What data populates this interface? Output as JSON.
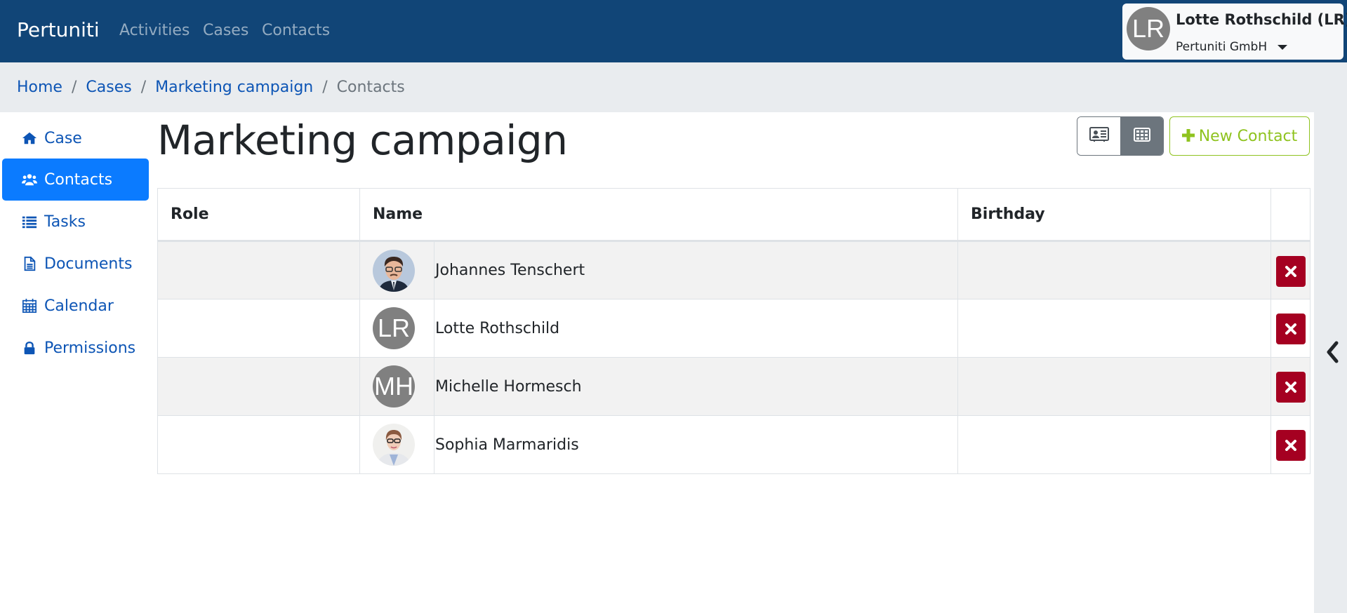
{
  "navbar": {
    "brand": "Pertuniti",
    "links": [
      "Activities",
      "Cases",
      "Contacts"
    ],
    "user": {
      "initials": "LR",
      "name": "Lotte Rothschild (LR)",
      "org": "Pertuniti GmbH"
    }
  },
  "breadcrumb": {
    "items": [
      "Home",
      "Cases",
      "Marketing campaign"
    ],
    "current": "Contacts",
    "separator": "/"
  },
  "sidebar": {
    "items": [
      {
        "label": "Case",
        "icon": "home-icon"
      },
      {
        "label": "Contacts",
        "icon": "users-icon",
        "active": true
      },
      {
        "label": "Tasks",
        "icon": "list-icon"
      },
      {
        "label": "Documents",
        "icon": "document-icon"
      },
      {
        "label": "Calendar",
        "icon": "calendar-icon"
      },
      {
        "label": "Permissions",
        "icon": "lock-icon"
      }
    ]
  },
  "page": {
    "title": "Marketing campaign"
  },
  "toolbar": {
    "view_modes": [
      "card-view",
      "table-view"
    ],
    "active_view": "table-view",
    "new_contact_label": "New Contact"
  },
  "table": {
    "headers": {
      "role": "Role",
      "name": "Name",
      "birthday": "Birthday",
      "action": ""
    },
    "rows": [
      {
        "role": "",
        "avatar_type": "photo",
        "initials": "",
        "name": "Johannes Tenschert",
        "birthday": ""
      },
      {
        "role": "",
        "avatar_type": "initials",
        "initials": "LR",
        "name": "Lotte Rothschild",
        "birthday": ""
      },
      {
        "role": "",
        "avatar_type": "initials",
        "initials": "MH",
        "name": "Michelle Hormesch",
        "birthday": ""
      },
      {
        "role": "",
        "avatar_type": "photo",
        "initials": "",
        "name": "Sophia Marmaridis",
        "birthday": ""
      }
    ]
  },
  "colors": {
    "navbar": "#114577",
    "active": "#0b7bff",
    "link": "#0d55b5",
    "success_outline": "#8fc31f",
    "danger": "#a50021",
    "avatar_gray": "#808080"
  }
}
